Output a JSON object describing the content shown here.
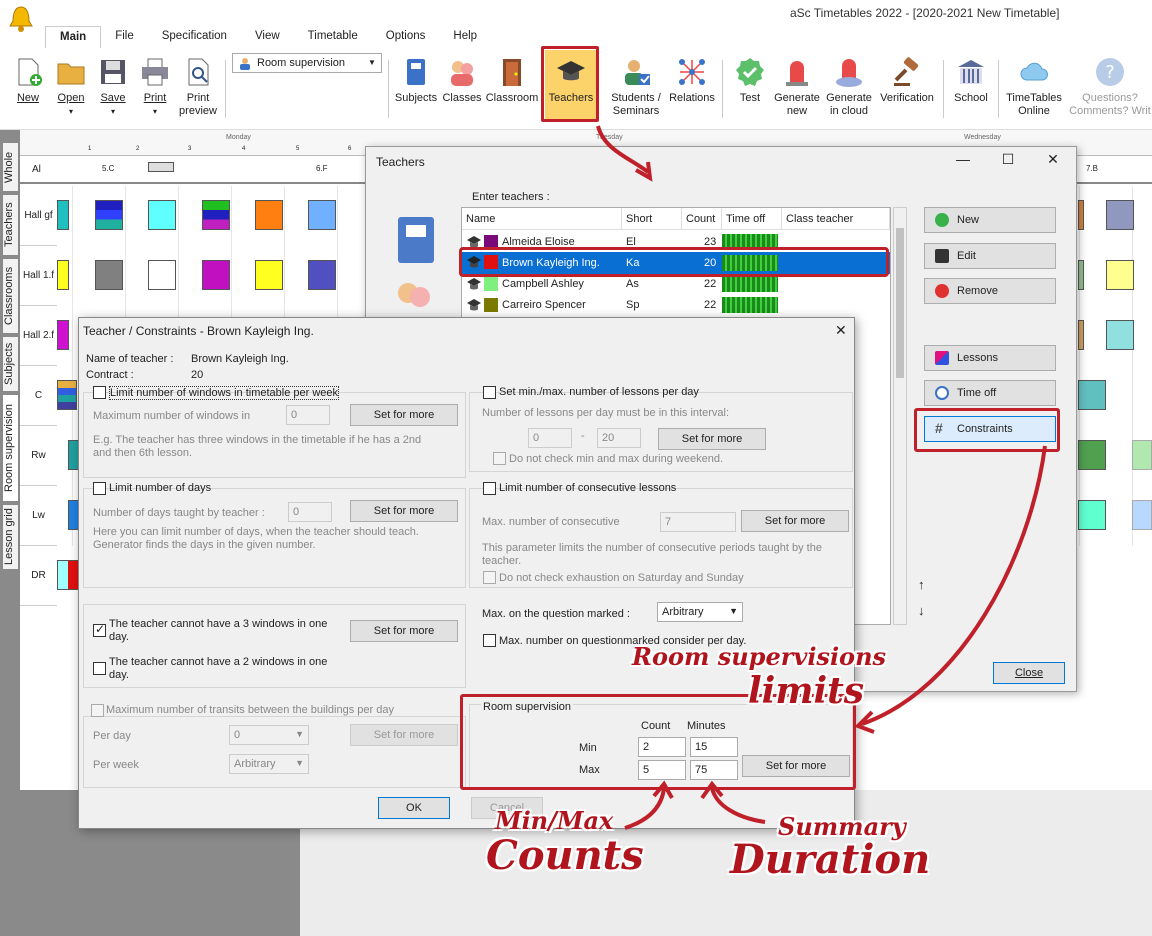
{
  "app": {
    "title": "aSc Timetables 2022  - [2020-2021 New Timetable]"
  },
  "menu": [
    "Main",
    "File",
    "Specification",
    "View",
    "Timetable",
    "Options",
    "Help"
  ],
  "ribbon": {
    "new": "New",
    "open": "Open",
    "save": "Save",
    "print": "Print",
    "print_preview": "Print preview",
    "view_combo": "Room supervision",
    "subjects": "Subjects",
    "classes": "Classes",
    "classroom": "Classroom",
    "teachers": "Teachers",
    "students_seminars": "Students / Seminars",
    "relations": "Relations",
    "test": "Test",
    "generate_new": "Generate new",
    "generate_cloud": "Generate in cloud",
    "verification": "Verification",
    "school": "School",
    "timetables_online": "TimeTables Online",
    "questions": "Questions? Comments? Writ"
  },
  "left_tabs": [
    "Whole",
    "Teachers",
    "Classrooms",
    "Subjects",
    "Room supervision",
    "Lesson grid"
  ],
  "grid": {
    "days": [
      "Monday",
      "Tuesday",
      "Wednesday"
    ],
    "periods": [
      "1",
      "2",
      "3",
      "4",
      "5",
      "6"
    ],
    "top_row": {
      "label": "Al",
      "c1": "5.C",
      "c2": "6.F",
      "c3": "7.B"
    },
    "rows": [
      "Hall gf",
      "Hall 1.f",
      "Hall 2.f",
      "C",
      "Rw",
      "Lw",
      "DR"
    ]
  },
  "teachers_window": {
    "title": "Teachers",
    "enter_label": "Enter teachers :",
    "columns": [
      "Name",
      "Short",
      "Count",
      "Time off",
      "Class teacher"
    ],
    "rows": [
      {
        "name": "Almeida Eloise",
        "short": "El",
        "count": "23",
        "color": "#7a0a7a"
      },
      {
        "name": "Brown Kayleigh Ing.",
        "short": "Ka",
        "count": "20",
        "color": "#e01010"
      },
      {
        "name": "Campbell Ashley",
        "short": "As",
        "count": "22",
        "color": "#7ff07f"
      },
      {
        "name": "Carreiro Spencer",
        "short": "Sp",
        "count": "22",
        "color": "#7a7a00"
      }
    ],
    "buttons": {
      "new": "New",
      "edit": "Edit",
      "remove": "Remove",
      "lessons": "Lessons",
      "time_off": "Time off",
      "constraints": "Constraints",
      "close": "Close"
    }
  },
  "constraints": {
    "title": "Teacher / Constraints - Brown Kayleigh Ing.",
    "name_label": "Name of teacher :",
    "name_value": "Brown Kayleigh Ing.",
    "contract_label": "Contract :",
    "contract_value": "20",
    "windows": {
      "label": "Limit number of windows in timetable per week",
      "max_label": "Maximum number of windows in",
      "value": "0",
      "desc": "E.g. The teacher has three windows in the timetable if he has a 2nd and then 6th lesson."
    },
    "lessons_per_day": {
      "label": "Set min./max. number of lessons per day",
      "interval_label": "Number of lessons per day must be in this interval:",
      "min": "0",
      "dash": "-",
      "max": "20",
      "weekend": "Do not check min and max during weekend."
    },
    "days": {
      "label": "Limit number of days",
      "taught_label": "Number of days taught by teacher :",
      "value": "0",
      "desc": "Here you can limit number of days, when the teacher should teach. Generator finds the days in the given number."
    },
    "consecutive": {
      "label": "Limit number of consecutive lessons",
      "max_label": "Max. number of consecutive",
      "value": "7",
      "desc": "This parameter limits the number of consecutive periods taught by the teacher.",
      "exhaustion": "Do not check exhaustion on Saturday and Sunday"
    },
    "three_windows": "The teacher cannot have a 3 windows in one day.",
    "two_windows": "The teacher cannot have a 2 windows in one day.",
    "question_label": "Max. on the question marked :",
    "question_value": "Arbitrary",
    "questionmarked": "Max. number on questionmarked consider per day.",
    "transits": {
      "label": "Maximum number of transits between the buildings per day",
      "per_day": "Per day",
      "per_day_value": "0",
      "per_week": "Per week",
      "per_week_value": "Arbitrary"
    },
    "room_supervision": {
      "title": "Room supervision",
      "count_label": "Count",
      "minutes_label": "Minutes",
      "min_label": "Min",
      "max_label": "Max",
      "min_count": "2",
      "min_minutes": "15",
      "max_count": "5",
      "max_minutes": "75"
    },
    "set_for_more": "Set for more",
    "ok": "OK",
    "cancel": "Cancel"
  },
  "annotations": {
    "room_limits_1": "Room supervisions",
    "room_limits_2": "limits",
    "counts_1": "Min/Max",
    "counts_2": "Counts",
    "duration_1": "Summary",
    "duration_2": "Duration"
  },
  "colors": {
    "accent_red": "#c0202a",
    "selection_blue": "#0a6fd3"
  }
}
